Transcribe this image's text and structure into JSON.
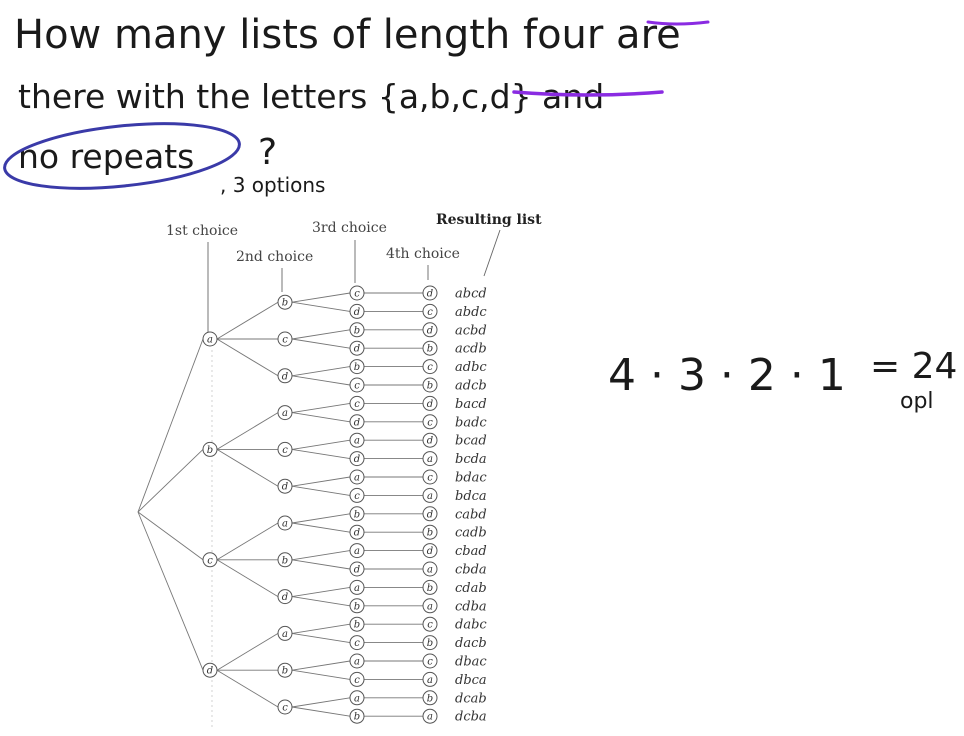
{
  "question": {
    "line1": "How many lists of length four are",
    "line2": "there with the letters {a,b,c,d} and",
    "line3_circled": "no repeats",
    "line3_tail": "?"
  },
  "side_note": ", 3 options",
  "formula": {
    "expression": "4 · 3 · 2 · 1",
    "result": "= 24",
    "unit_note": "opl"
  },
  "tree": {
    "headers": {
      "first": "1st choice",
      "second": "2nd choice",
      "third": "3rd choice",
      "fourth": "4th choice",
      "result": "Resulting list"
    },
    "letters": [
      "a",
      "b",
      "c",
      "d"
    ],
    "resulting_lists": [
      "abcd",
      "abdc",
      "acbd",
      "acdb",
      "adbc",
      "adcb",
      "bacd",
      "badc",
      "bcad",
      "bcda",
      "bdac",
      "bdca",
      "cabd",
      "cadb",
      "cbad",
      "cbda",
      "cdab",
      "cdba",
      "dabc",
      "dacb",
      "dbac",
      "dbca",
      "dcab",
      "dcba"
    ]
  },
  "colors": {
    "ink": "#1a1a1a",
    "highlight": "#8a2be2",
    "circle": "#3a3aa8"
  }
}
